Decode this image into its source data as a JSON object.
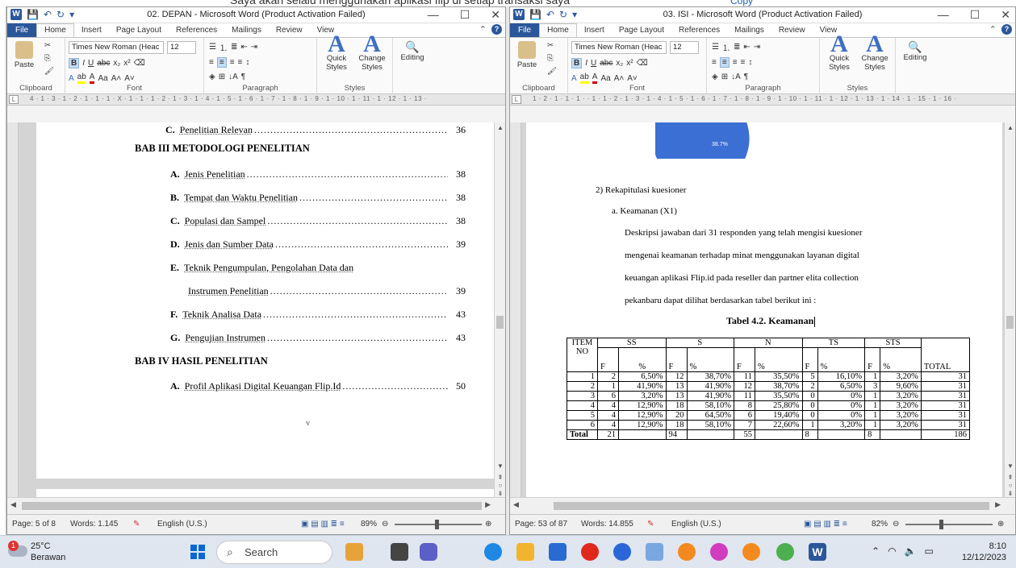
{
  "background": {
    "text": "Saya akan selalu menggunakan aplikasi flip di setiap transaksi saya",
    "copy_label": "Copy"
  },
  "left_window": {
    "title": "02. DEPAN  -  Microsoft Word (Product Activation Failed)",
    "tabs": [
      "File",
      "Home",
      "Insert",
      "Page Layout",
      "References",
      "Mailings",
      "Review",
      "View"
    ],
    "font_name": "Times New Roman (Heac",
    "font_size": "12",
    "groups": {
      "clipboard": "Clipboard",
      "font": "Font",
      "paragraph": "Paragraph",
      "styles": "Styles"
    },
    "buttons": {
      "paste": "Paste",
      "quick_styles": "Quick Styles",
      "change_styles": "Change Styles",
      "editing": "Editing"
    },
    "ruler": "4 · 1 · 3 · 1 · 2 · 1 · 1 · 1 · X · 1 · 1 · 1 · 2 · 1 · 3 · 1 · 4 · 1 · 5 · 1 · 6 · 1 · 7 · 1 · 8 · 1 · 9 · 1 · 10 · 1 · 11 · 1 · 12 · 1 · 13 ·",
    "toc": {
      "c_label": "C.",
      "c_text": "Penelitian Relevan",
      "c_page": "36",
      "bab3": "BAB III METODOLOGI PENELITIAN",
      "items3": [
        {
          "label": "A.",
          "text": "Jenis Penelitian",
          "page": "38"
        },
        {
          "label": "B.",
          "text": "Tempat dan Waktu Penelitian",
          "page": "38"
        },
        {
          "label": "C.",
          "text": "Populasi dan Sampel",
          "page": "38"
        },
        {
          "label": "D.",
          "text": "Jenis dan Sumber Data",
          "page": "39"
        },
        {
          "label": "E.",
          "text": "Teknik Pengumpulan, Pengolahan Data dan",
          "page": ""
        },
        {
          "label": "",
          "text": "Instrumen Penelitian",
          "page": "39"
        },
        {
          "label": "F.",
          "text": "Teknik Analisa Data",
          "page": "43"
        },
        {
          "label": "G.",
          "text": "Pengujian Instrumen",
          "page": "43"
        }
      ],
      "bab4": "BAB IV HASIL PENELITIAN",
      "items4": [
        {
          "label": "A.",
          "text": "Profil Aplikasi Digital Keuangan Flip.Id",
          "page": "50"
        }
      ],
      "page_numeral": "v"
    },
    "status": {
      "page": "Page: 5 of 8",
      "words": "Words: 1.145",
      "language": "English (U.S.)",
      "zoom": "89%"
    }
  },
  "right_window": {
    "title": "03. ISI  -  Microsoft Word (Product Activation Failed)",
    "tabs": [
      "File",
      "Home",
      "Insert",
      "Page Layout",
      "References",
      "Mailings",
      "Review",
      "View"
    ],
    "font_name": "Times New Roman (Heac",
    "font_size": "12",
    "groups": {
      "clipboard": "Clipboard",
      "font": "Font",
      "paragraph": "Paragraph",
      "styles": "Styles"
    },
    "buttons": {
      "paste": "Paste",
      "quick_styles": "Quick Styles",
      "change_styles": "Change Styles",
      "editing": "Editing"
    },
    "ruler": "1 · 2 · 1 · 1 · 1 ·   · 1 · 1 · 2 · 1 · 3 · 1 · 4 · 1 · 5 · 1 · 6 · 1 · 7 · 1 · 8 · 1 · 9 · 1 · 10 · 1 · 11 · 1 · 12 · 1 · 13 · 1 · 14 · 1 · 15 · 1 · 16 ·",
    "pie_label": "38.7%",
    "heading2": "2)  Rekapitulasi kuesioner",
    "heading_a": "a.   Keamanan (X1)",
    "paragraph": [
      "Deskripsi  jawaban dari 31 responden yang telah mengisi kuesioner",
      "mengenai keamanan terhadap minat menggunakan layanan digital",
      "keuangan aplikasi Flip.id pada reseller dan partner elita collection",
      "pekanbaru dapat dilihat berdasarkan tabel berikut ini :"
    ],
    "table_caption": "Tabel 4.2. Keamanan",
    "table": {
      "item_no": "ITEM NO",
      "groups": [
        "SS",
        "S",
        "N",
        "TS",
        "STS"
      ],
      "sub": [
        "F",
        "%"
      ],
      "total_label": "TOTAL",
      "rows": [
        [
          "1",
          "2",
          "6,50%",
          "12",
          "38,70%",
          "11",
          "35,50%",
          "5",
          "16,10%",
          "1",
          "3,20%",
          "31"
        ],
        [
          "2",
          "1",
          "41,90%",
          "13",
          "41,90%",
          "12",
          "38,70%",
          "2",
          "6,50%",
          "3",
          "9,60%",
          "31"
        ],
        [
          "3",
          "6",
          "3,20%",
          "13",
          "41,90%",
          "11",
          "35,50%",
          "0",
          "0%",
          "1",
          "3,20%",
          "31"
        ],
        [
          "4",
          "4",
          "12,90%",
          "18",
          "58,10%",
          "8",
          "25,80%",
          "0",
          "0%",
          "1",
          "3,20%",
          "31"
        ],
        [
          "5",
          "4",
          "12,90%",
          "20",
          "64,50%",
          "6",
          "19,40%",
          "0",
          "0%",
          "1",
          "3,20%",
          "31"
        ],
        [
          "6",
          "4",
          "12,90%",
          "18",
          "58,10%",
          "7",
          "22,60%",
          "1",
          "3,20%",
          "1",
          "3,20%",
          "31"
        ]
      ],
      "total_row": [
        "Total",
        "21",
        "",
        "94",
        "",
        "55",
        "",
        "8",
        "",
        "8",
        "",
        "186"
      ]
    },
    "status": {
      "page": "Page: 53 of 87",
      "words": "Words: 14.855",
      "language": "English (U.S.)",
      "zoom": "82%"
    }
  },
  "taskbar": {
    "weather_temp": "25°C",
    "weather_desc": "Berawan",
    "weather_badge": "1",
    "search": "Search",
    "time": "8:10",
    "date": "12/12/2023"
  },
  "colors": {
    "word_blue": "#2b579a",
    "pie_blue": "#3b6fd4",
    "pie_red": "#d94a2b"
  }
}
